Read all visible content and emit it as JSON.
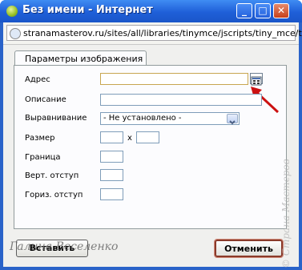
{
  "window": {
    "title": "Без имени - Интернет",
    "controls": {
      "minimize": "_",
      "maximize": "□",
      "close": "✕"
    }
  },
  "address_bar": {
    "url": "stranamasterov.ru/sites/all/libraries/tinymce/jscripts/tiny_mce/them"
  },
  "dialog": {
    "tab_label": "Параметры изображения",
    "fields": {
      "address_label": "Адрес",
      "description_label": "Описание",
      "align_label": "Выравнивание",
      "align_value": "- Не установлено -",
      "size_label": "Размер",
      "size_separator": "x",
      "border_label": "Граница",
      "vspace_label": "Верт. отступ",
      "hspace_label": "Гориз. отступ"
    },
    "buttons": {
      "insert": "Вставить",
      "cancel": "Отменить"
    }
  },
  "watermarks": {
    "author": "Галина Веселенко",
    "site": "© Страна Мастеров"
  },
  "colors": {
    "titlebar": "#1f5fd8",
    "arrow": "#cc1111"
  }
}
